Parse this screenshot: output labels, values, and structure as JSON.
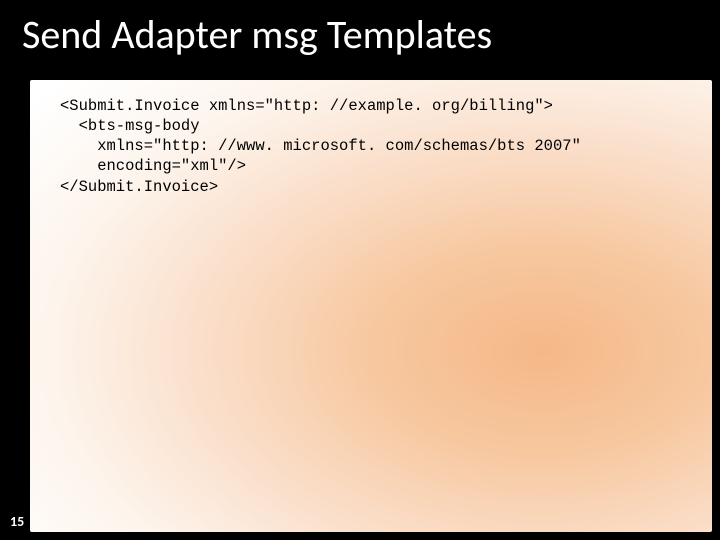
{
  "slide": {
    "title": "Send Adapter msg Templates",
    "pageNumber": "15",
    "code": {
      "line1": "<Submit.Invoice xmlns=\"http: //example. org/billing\">",
      "line2": "  <bts-msg-body",
      "line3": "    xmlns=\"http: //www. microsoft. com/schemas/bts 2007\"",
      "line4": "    encoding=\"xml\"/>",
      "line5": "</Submit.Invoice>"
    }
  }
}
